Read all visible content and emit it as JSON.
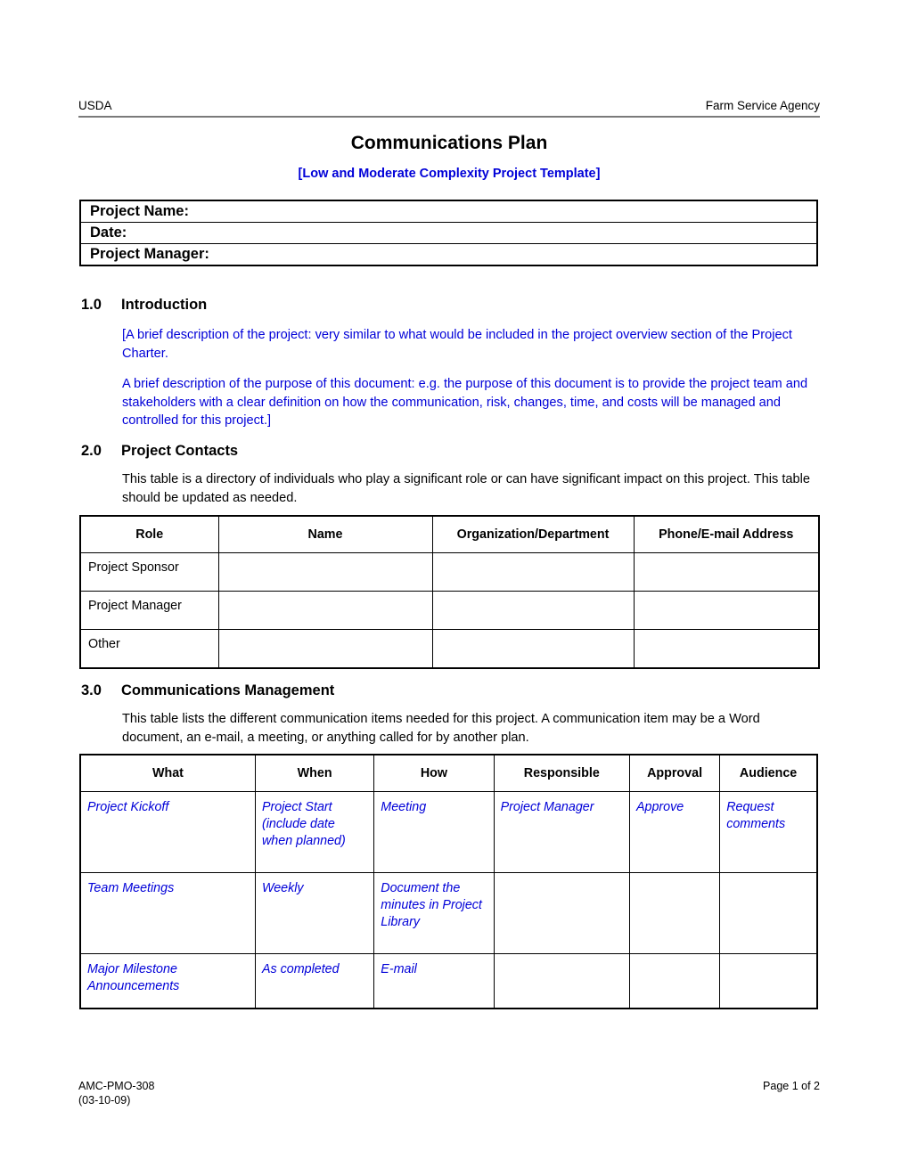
{
  "header": {
    "left": "USDA",
    "right": "Farm Service Agency"
  },
  "title": "Communications Plan",
  "subtitle": "[Low and Moderate Complexity Project Template]",
  "colors": {
    "instruction_blue": "#0000d8",
    "text_black": "#000000",
    "rule_gray": "#7a7a7a"
  },
  "info_table": {
    "rows": [
      {
        "label": "Project Name:",
        "value": ""
      },
      {
        "label": "Date:",
        "value": ""
      },
      {
        "label": "Project Manager:",
        "value": ""
      }
    ]
  },
  "sections": {
    "introduction": {
      "number": "1.0",
      "title": "Introduction",
      "paragraph1": "[A brief description of the project: very similar to what would be included in the project overview section of the Project Charter.",
      "paragraph2": "A brief description of the purpose of this document: e.g. the purpose of this document is to provide the project team and stakeholders with a clear definition on how the communication, risk, changes, time, and costs will be managed and controlled for this project.]"
    },
    "project_contacts": {
      "number": "2.0",
      "title": "Project Contacts",
      "paragraph1": "This table is a directory of individuals who play a significant role or can have significant impact on this project.  This table should be updated as needed."
    },
    "communications_management": {
      "number": "3.0",
      "title": "Communications Management",
      "paragraph1": "This table lists the different communication items needed for this project.  A communication item may be a Word document, an e-mail, a meeting, or anything called for by another plan."
    }
  },
  "contacts_table": {
    "headers": [
      "Role",
      "Name",
      "Organization/Department",
      "Phone/E-mail Address"
    ],
    "rows": [
      {
        "role": "Project Sponsor",
        "name": "",
        "organization": "",
        "phone": ""
      },
      {
        "role": "Project Manager",
        "name": "",
        "organization": "",
        "phone": ""
      },
      {
        "role": "Other",
        "name": "",
        "organization": "",
        "phone": ""
      }
    ]
  },
  "comms_table": {
    "headers": [
      "What",
      "When",
      "How",
      "Responsible",
      "Approval",
      "Audience"
    ],
    "rows": [
      {
        "what": "Project Kickoff",
        "when": "Project Start (include date when planned)",
        "how": "Meeting",
        "responsible": "Project Manager",
        "approval": "Approve",
        "audience": "Request comments"
      },
      {
        "what": "Team Meetings",
        "when": "Weekly",
        "how": "Document the minutes in Project Library",
        "responsible": "",
        "approval": "",
        "audience": ""
      },
      {
        "what": "Major Milestone Announcements",
        "when": "As completed",
        "how": "E-mail",
        "responsible": "",
        "approval": "",
        "audience": ""
      }
    ]
  },
  "footer": {
    "form_number": "AMC-PMO-308",
    "form_date": "(03-10-09)",
    "page_number": "Page 1 of 2"
  }
}
